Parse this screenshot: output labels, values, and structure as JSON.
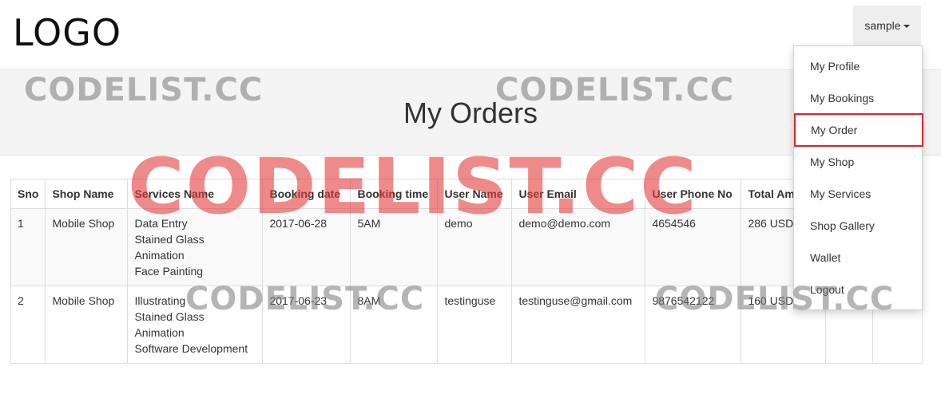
{
  "header": {
    "logo": "LOGO",
    "user_menu_label": "sample"
  },
  "page": {
    "title": "My Orders"
  },
  "dropdown": {
    "items": [
      {
        "label": "My Profile"
      },
      {
        "label": "My Bookings"
      },
      {
        "label": "My Order",
        "active": true
      },
      {
        "label": "My Shop"
      },
      {
        "label": "My Services"
      },
      {
        "label": "Shop Gallery"
      },
      {
        "label": "Wallet"
      },
      {
        "label": "Logout"
      }
    ]
  },
  "table": {
    "columns": [
      "Sno",
      "Shop Name",
      "Services Name",
      "Booking date",
      "Booking time",
      "User Name",
      "User Email",
      "User Phone No",
      "Total Amount",
      "",
      ""
    ],
    "rows": [
      {
        "sno": "1",
        "shop": "Mobile Shop",
        "services": [
          "Data Entry",
          "Stained Glass",
          "Animation",
          "Face Painting"
        ],
        "date": "2017-06-28",
        "time": "5AM",
        "user": "demo",
        "email": "demo@demo.com",
        "phone": "4654546",
        "total": "286 USD"
      },
      {
        "sno": "2",
        "shop": "Mobile Shop",
        "services": [
          "Illustrating",
          "Stained Glass",
          "Animation",
          "Software Development"
        ],
        "date": "2017-06-23",
        "time": "8AM",
        "user": "testinguse",
        "email": "testinguse@gmail.com",
        "phone": "9876542122",
        "total": "160 USD"
      }
    ]
  },
  "watermarks": {
    "small": "CODELIST.CC",
    "large": "CODELIST.CC"
  },
  "colors": {
    "active_outline": "#d9262b",
    "watermark_red": "#e43c3c"
  }
}
